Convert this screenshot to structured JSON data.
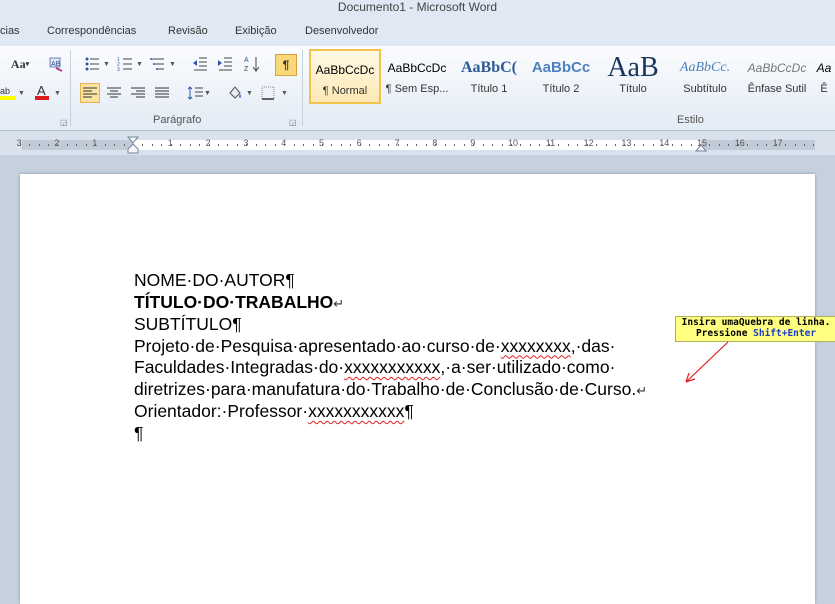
{
  "window": {
    "title": "Documento1  -  Microsoft Word"
  },
  "tabs": [
    "cias",
    "Correspondências",
    "Revisão",
    "Exibição",
    "Desenvolvedor"
  ],
  "ribbon": {
    "groups": {
      "paragraph": "Parágrafo",
      "styles": "Estilo"
    },
    "font_case_label": "Aa",
    "pilcrow": "¶"
  },
  "styles_gallery": [
    {
      "sample": "AaBbCcDc",
      "name": "¶ Normal",
      "selected": true
    },
    {
      "sample": "AaBbCcDc",
      "name": "¶ Sem Esp..."
    },
    {
      "sample": "AaBbC(",
      "name": "Título 1"
    },
    {
      "sample": "AaBbCc",
      "name": "Título 2"
    },
    {
      "sample": "AaB",
      "name": "Título"
    },
    {
      "sample": "AaBbCc.",
      "name": "Subtítulo"
    },
    {
      "sample": "AaBbCcDc",
      "name": "Ênfase Sutil"
    },
    {
      "sample": "Aa",
      "name": "Ê"
    }
  ],
  "ruler": {
    "numbers": [
      "3",
      "2",
      "1",
      "1",
      "2",
      "3",
      "4",
      "5",
      "6",
      "7",
      "8",
      "9",
      "10",
      "11",
      "12",
      "13",
      "14",
      "15",
      "16",
      "17"
    ]
  },
  "document": {
    "line1": "NOME·DO·AUTOR¶",
    "line2": "TÍTULO·DO·TRABALHO",
    "line2_mark": "↵",
    "line3": "SUBTÍTULO¶",
    "p4a": "Projeto·de·Pesquisa·apresentado·ao·curso·de·",
    "p4b": "xxxxxxxx",
    "p4c": ",·das·",
    "p5a": "Faculdades·Integradas·do·",
    "p5b": "xxxxxxxxxxx",
    "p5c": ",·a·ser·utilizado·como·",
    "p6": "diretrizes·para·manufatura·do·Trabalho·de·Conclusão·de·Curso.",
    "p6_mark": "↵",
    "p7a": "Orientador:·Professor·",
    "p7b": "xxxxxxxxxxx",
    "p7c": "¶",
    "p8": "¶"
  },
  "callout": {
    "line1": "Insira umaQuebra de linha.",
    "line2_pre": "Pressione ",
    "line2_keys": "Shift+Enter"
  }
}
